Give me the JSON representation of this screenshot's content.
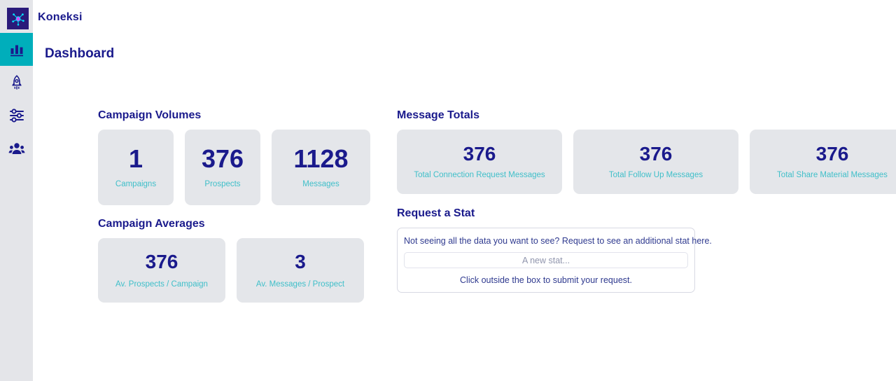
{
  "brand": {
    "name": "Koneksi",
    "logo_icon": "network-node-icon",
    "logo_bg": "#2a1a7a",
    "logo_accent": "#00e5ff"
  },
  "theme": {
    "navy": "#1a1a8c",
    "teal": "#00aebb",
    "label_teal": "#3fbfc9",
    "sidebar_bg": "#e4e5e9",
    "card_bg": "#e4e6ea"
  },
  "sidebar": {
    "items": [
      {
        "name": "dashboard",
        "icon": "bar-chart-icon",
        "active": true
      },
      {
        "name": "campaigns",
        "icon": "rocket-icon",
        "active": false
      },
      {
        "name": "settings",
        "icon": "sliders-icon",
        "active": false
      },
      {
        "name": "prospects",
        "icon": "people-group-icon",
        "active": false
      }
    ]
  },
  "header": {
    "page_title": "Dashboard"
  },
  "sections": {
    "campaign_volumes": {
      "title": "Campaign Volumes",
      "cards": [
        {
          "value": "1",
          "label": "Campaigns"
        },
        {
          "value": "376",
          "label": "Prospects"
        },
        {
          "value": "1128",
          "label": "Messages"
        }
      ]
    },
    "campaign_averages": {
      "title": "Campaign Averages",
      "cards": [
        {
          "value": "376",
          "label": "Av. Prospects / Campaign"
        },
        {
          "value": "3",
          "label": "Av. Messages / Prospect"
        }
      ]
    },
    "message_totals": {
      "title": "Message Totals",
      "cards": [
        {
          "value": "376",
          "label": "Total Connection Request Messages"
        },
        {
          "value": "376",
          "label": "Total Follow Up Messages"
        },
        {
          "value": "376",
          "label": "Total Share Material Messages"
        }
      ]
    },
    "request_a_stat": {
      "title": "Request a Stat",
      "prompt": "Not seeing all the data you want to see? Request to see an additional stat here.",
      "input_value": "",
      "input_placeholder": "A new stat...",
      "hint": "Click outside the box to submit your request."
    }
  }
}
